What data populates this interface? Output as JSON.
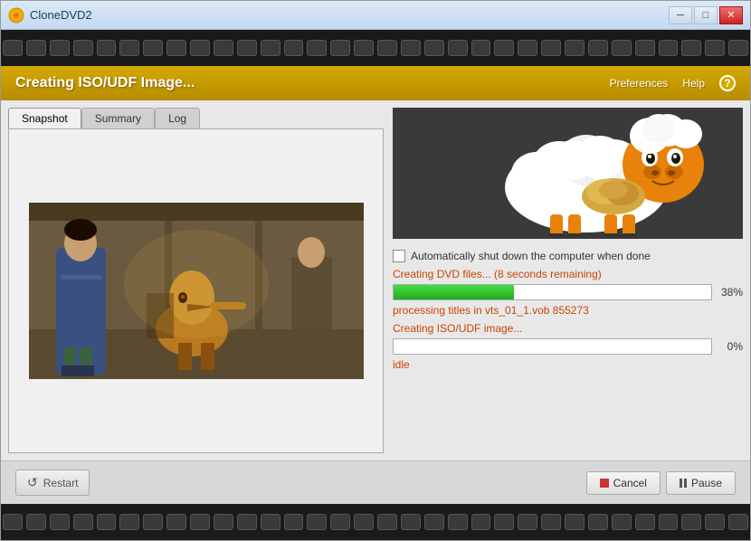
{
  "window": {
    "title": "CloneDVD2",
    "icon": "dvd-icon"
  },
  "titlebar": {
    "title": "CloneDVD2",
    "minimize_label": "─",
    "maximize_label": "□",
    "close_label": "✕"
  },
  "header": {
    "title": "Creating ISO/UDF Image...",
    "preferences_label": "Preferences",
    "help_label": "Help",
    "help_icon": "?"
  },
  "tabs": [
    {
      "label": "Snapshot",
      "active": true
    },
    {
      "label": "Summary",
      "active": false
    },
    {
      "label": "Log",
      "active": false
    }
  ],
  "controls": {
    "auto_shutdown_label": "Automatically shut down the computer when done",
    "auto_shutdown_checked": false
  },
  "progress1": {
    "label": "Creating DVD files... (8 seconds remaining)",
    "percent": 38,
    "percent_label": "38%"
  },
  "progress2": {
    "label": "Creating ISO/UDF image...",
    "status": "processing titles in vts_01_1.vob 855273",
    "percent": 0,
    "percent_label": "0%"
  },
  "idle_text": "idle",
  "buttons": {
    "restart_label": "Restart",
    "cancel_label": "Cancel",
    "pause_label": "Pause"
  },
  "filmstrip": {
    "hole_count": 32
  }
}
